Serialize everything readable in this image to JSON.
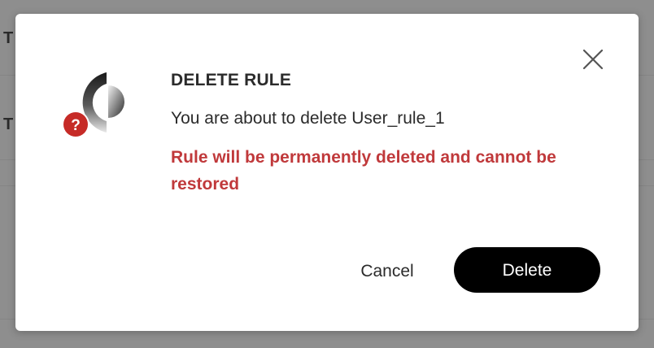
{
  "background": {
    "row_labels": [
      "T",
      "T"
    ]
  },
  "dialog": {
    "title": "DELETE RULE",
    "message": "You are about to delete User_rule_1",
    "warning": "Rule will be permanently deleted and cannot be restored",
    "icon": "question-badge-icon",
    "close_icon": "close-icon",
    "cancel_label": "Cancel",
    "delete_label": "Delete"
  },
  "colors": {
    "warning_text": "#c0393b",
    "primary_button": "#000000",
    "badge_red": "#c62b27"
  }
}
